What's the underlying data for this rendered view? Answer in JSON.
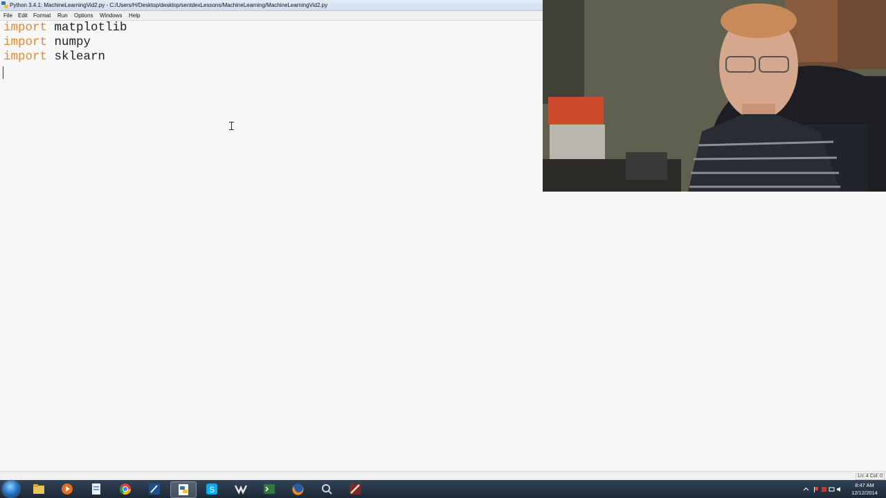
{
  "window": {
    "title": "Python 3.4.1: MachineLearningVid2.py - C:/Users/H/Desktop/desktop/sentdexLessons/MachineLearning/MachineLearningVid2.py"
  },
  "menu": [
    "File",
    "Edit",
    "Format",
    "Run",
    "Options",
    "Windows",
    "Help"
  ],
  "code": [
    {
      "keyword": "import",
      "module": " matplotlib"
    },
    {
      "keyword": "import",
      "module": " numpy"
    },
    {
      "keyword": "import",
      "module": " sklearn"
    }
  ],
  "status": {
    "position": "Ln: 4 Col: 0"
  },
  "clock": {
    "time": "8:47 AM",
    "date": "12/12/2014"
  },
  "colors": {
    "keyword": "#e08a3c",
    "text": "#222222",
    "editor_bg": "#f7f7f7"
  },
  "taskbar_icons": [
    "start-orb",
    "file-explorer-icon",
    "media-player-icon",
    "document-icon",
    "chrome-icon",
    "sketch-app-icon",
    "python-idle-icon",
    "skype-icon",
    "vs-icon",
    "terminal-icon",
    "firefox-icon",
    "search-app-icon",
    "paint-app-icon"
  ]
}
